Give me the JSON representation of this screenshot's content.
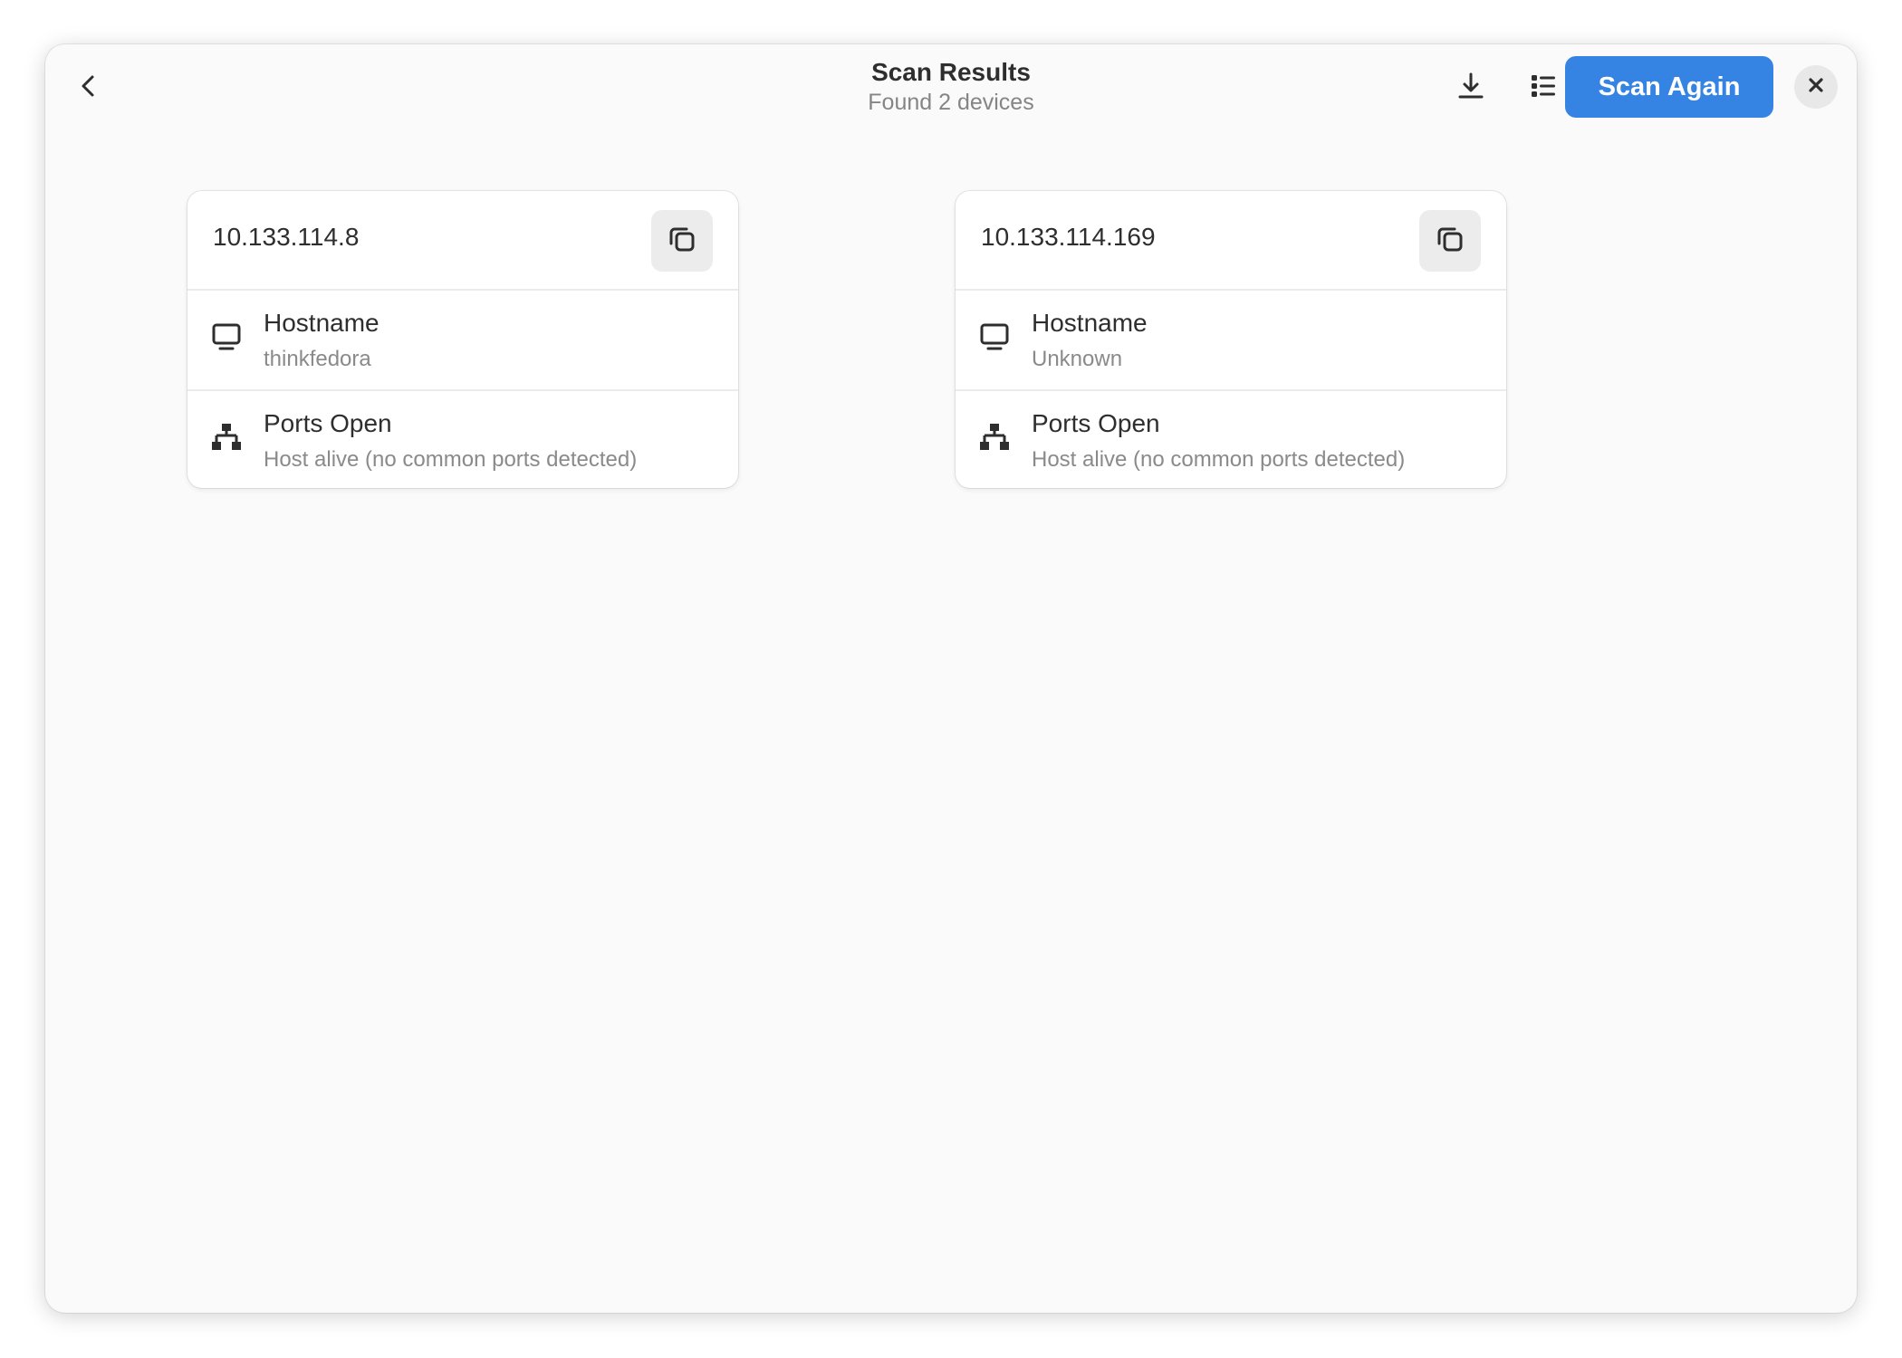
{
  "header": {
    "title": "Scan Results",
    "subtitle": "Found 2 devices",
    "scan_again_label": "Scan Again",
    "icons": {
      "back": "chevron-left-icon",
      "download": "download-icon",
      "list": "list-icon",
      "close": "close-icon"
    }
  },
  "colors": {
    "accent": "#3584e4",
    "window_bg": "#fafafa",
    "card_bg": "#ffffff"
  },
  "devices": [
    {
      "ip": "10.133.114.8",
      "hostname_label": "Hostname",
      "hostname": "thinkfedora",
      "ports_label": "Ports Open",
      "ports": "Host alive (no common ports detected)"
    },
    {
      "ip": "10.133.114.169",
      "hostname_label": "Hostname",
      "hostname": "Unknown",
      "ports_label": "Ports Open",
      "ports": "Host alive (no common ports detected)"
    }
  ]
}
